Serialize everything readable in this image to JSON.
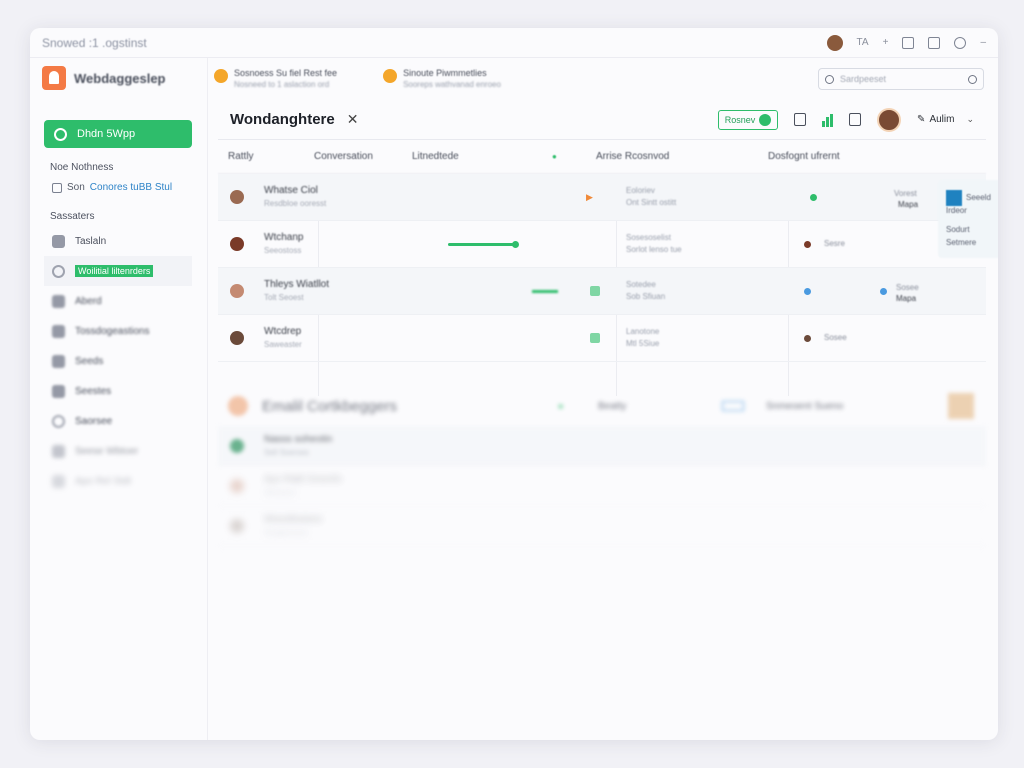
{
  "window": {
    "title": "Snowed :1 .ogstinst",
    "user_short": "TA"
  },
  "sidebar": {
    "logo_name": "Webdaggeslep",
    "primary_button": "Dhdn 5Wpp",
    "section1_label": "Noe Nothness",
    "check": {
      "prefix": "Son",
      "link": "Conores tuBB Stul"
    },
    "section2_label": "Sassaters",
    "items": [
      {
        "label": "Taslaln",
        "icon": "user-icon"
      },
      {
        "label": "Woilitial liltenrders",
        "icon": "circle-icon",
        "active": true
      },
      {
        "label": "Aberd",
        "icon": "user-icon"
      },
      {
        "label": "Tossdogeastions",
        "icon": "grid-icon"
      },
      {
        "label": "Seeds",
        "icon": "grid-icon"
      },
      {
        "label": "Seestes",
        "icon": "grid-icon"
      },
      {
        "label": "Saorsee",
        "icon": "gear-icon"
      },
      {
        "label": "Seese Wbtoer",
        "icon": "doc-icon"
      },
      {
        "label": "Apo Rel Stdt",
        "icon": "plus-icon"
      }
    ]
  },
  "infostrip": [
    {
      "title": "Sosnoess Su fiel Rest fee",
      "sub": "Nosneed to 1 aslaction ord"
    },
    {
      "title": "Sinoute Piwmmetlies",
      "sub": "Sooreps wathvanad enroeo"
    }
  ],
  "search": {
    "placeholder": "Sardpeeset"
  },
  "header": {
    "title": "Wondanghtere",
    "badge": "Rosnev",
    "user": "Aulim"
  },
  "columns": [
    "Rattly",
    "Conversation",
    "Litnedtede",
    "Arrise Rcosnvod",
    "Dosfognt ufrernt"
  ],
  "rows": [
    {
      "name": "Whatse Ciol",
      "sub": "Resdbloe ooresst",
      "c2": "Eoloriev",
      "c2b": "Ont Sintt ostitt",
      "c3": "Vorest",
      "c4": "Mapa"
    },
    {
      "name": "Wtchanp",
      "sub": "Seeostoss",
      "c2": "Sosesoselist",
      "c2b": "Sorlot lenso tue",
      "c3": "Sesre",
      "c4": ""
    },
    {
      "name": "Thleys Wiatllot",
      "sub": "Tolt Seoest",
      "c2": "Sotedee",
      "c2b": "Sob Sfiuan",
      "c3": "Sosee",
      "c4": "Mapa"
    },
    {
      "name": "Wtcdrep",
      "sub": "Saweaster",
      "c2": "Lanotone",
      "c2b": "Mtl 5Siue",
      "c3": "Sosee",
      "c4": ""
    }
  ],
  "side_card": {
    "title": "Seeeld Irdeor",
    "line1": "Sodurt",
    "line2": "Setmere"
  },
  "section2": {
    "title": "Emalil Cortkbeggers",
    "col_a": "Beatty",
    "col_b": "Snmeoent Sueno",
    "rows": [
      {
        "name": "Nasss soheotin",
        "sub": "Sell Soerses"
      },
      {
        "name": "Ayo Raltt Smenfo",
        "sub": "Sbooloor"
      },
      {
        "name": "Woesllssiees",
        "sub": "Sesgessoes"
      }
    ]
  }
}
